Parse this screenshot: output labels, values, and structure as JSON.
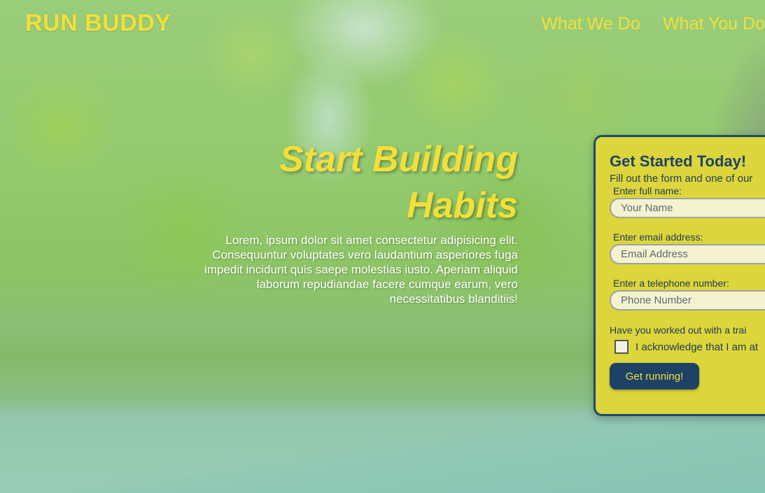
{
  "header": {
    "logo": "RUN BUDDY",
    "nav": [
      {
        "label": "What We Do"
      },
      {
        "label": "What You Do"
      }
    ]
  },
  "hero": {
    "title_line1": "Start Building",
    "title_line2": "Habits",
    "body": "Lorem, ipsum dolor sit amet consectetur adipisicing elit. Consequuntur voluptates vero laudantium asperiores fuga impedit incidunt quis saepe molestias iusto. Aperiam aliquid laborum repudiandae facere cumque earum, vero necessitatibus blanditiis!"
  },
  "form": {
    "title": "Get Started Today!",
    "subtitle": "Fill out the form and one of our",
    "name_label": "Enter full name:",
    "name_placeholder": "Your Name",
    "email_label": "Enter email address:",
    "email_placeholder": "Email Address",
    "phone_label": "Enter a telephone number:",
    "phone_placeholder": "Phone Number",
    "question": "Have you worked out with a trai",
    "acknowledge_label": "I acknowledge that I am at",
    "submit_label": "Get running!"
  },
  "colors": {
    "accent_yellow": "#f2df3a",
    "navy": "#1e4266",
    "form_bg": "#dcd53b"
  }
}
